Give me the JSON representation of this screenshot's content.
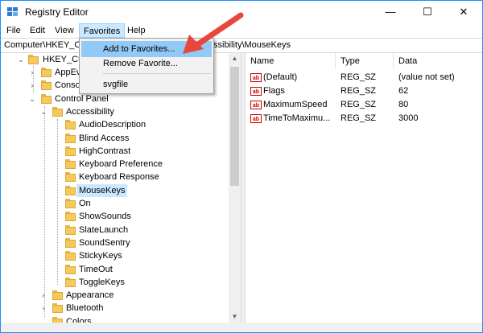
{
  "window": {
    "title": "Registry Editor",
    "minimize_glyph": "—",
    "maximize_glyph": "☐",
    "close_glyph": "✕"
  },
  "menubar": {
    "items": [
      "File",
      "Edit",
      "View",
      "Favorites",
      "Help"
    ],
    "active": "Favorites"
  },
  "address": {
    "left_text": "Computer\\HKEY_C",
    "right_text": "ssibility\\MouseKeys"
  },
  "favorites_menu": {
    "items": [
      "Add to Favorites...",
      "Remove Favorite...",
      "svgfile"
    ],
    "highlighted": "Add to Favorites..."
  },
  "tree": {
    "root": "HKEY_CU",
    "items": [
      {
        "label": "AppEv",
        "depth": 1,
        "expander": "collapsed"
      },
      {
        "label": "Conso",
        "depth": 1,
        "expander": "collapsed"
      },
      {
        "label": "Control Panel",
        "depth": 1,
        "expander": "expanded"
      },
      {
        "label": "Accessibility",
        "depth": 2,
        "expander": "expanded"
      },
      {
        "label": "AudioDescription",
        "depth": 3,
        "expander": "none"
      },
      {
        "label": "Blind Access",
        "depth": 3,
        "expander": "none"
      },
      {
        "label": "HighContrast",
        "depth": 3,
        "expander": "none"
      },
      {
        "label": "Keyboard Preference",
        "depth": 3,
        "expander": "none"
      },
      {
        "label": "Keyboard Response",
        "depth": 3,
        "expander": "none"
      },
      {
        "label": "MouseKeys",
        "depth": 3,
        "expander": "none",
        "selected": true
      },
      {
        "label": "On",
        "depth": 3,
        "expander": "none"
      },
      {
        "label": "ShowSounds",
        "depth": 3,
        "expander": "none"
      },
      {
        "label": "SlateLaunch",
        "depth": 3,
        "expander": "none"
      },
      {
        "label": "SoundSentry",
        "depth": 3,
        "expander": "none"
      },
      {
        "label": "StickyKeys",
        "depth": 3,
        "expander": "none"
      },
      {
        "label": "TimeOut",
        "depth": 3,
        "expander": "none"
      },
      {
        "label": "ToggleKeys",
        "depth": 3,
        "expander": "none"
      },
      {
        "label": "Appearance",
        "depth": 2,
        "expander": "collapsed"
      },
      {
        "label": "Bluetooth",
        "depth": 2,
        "expander": "collapsed"
      },
      {
        "label": "Colors",
        "depth": 2,
        "expander": "none"
      }
    ]
  },
  "values_list": {
    "columns": [
      "Name",
      "Type",
      "Data"
    ],
    "rows": [
      {
        "icon": "ab",
        "name": "(Default)",
        "type": "REG_SZ",
        "data": "(value not set)"
      },
      {
        "icon": "ab",
        "name": "Flags",
        "type": "REG_SZ",
        "data": "62"
      },
      {
        "icon": "ab",
        "name": "MaximumSpeed",
        "type": "REG_SZ",
        "data": "80"
      },
      {
        "icon": "ab",
        "name": "TimeToMaximu...",
        "type": "REG_SZ",
        "data": "3000"
      }
    ]
  },
  "colors": {
    "selection": "#cce8ff",
    "menu_hover": "#91c9f7",
    "annotation_arrow": "#e8473c",
    "folder": "#f5c95a"
  }
}
